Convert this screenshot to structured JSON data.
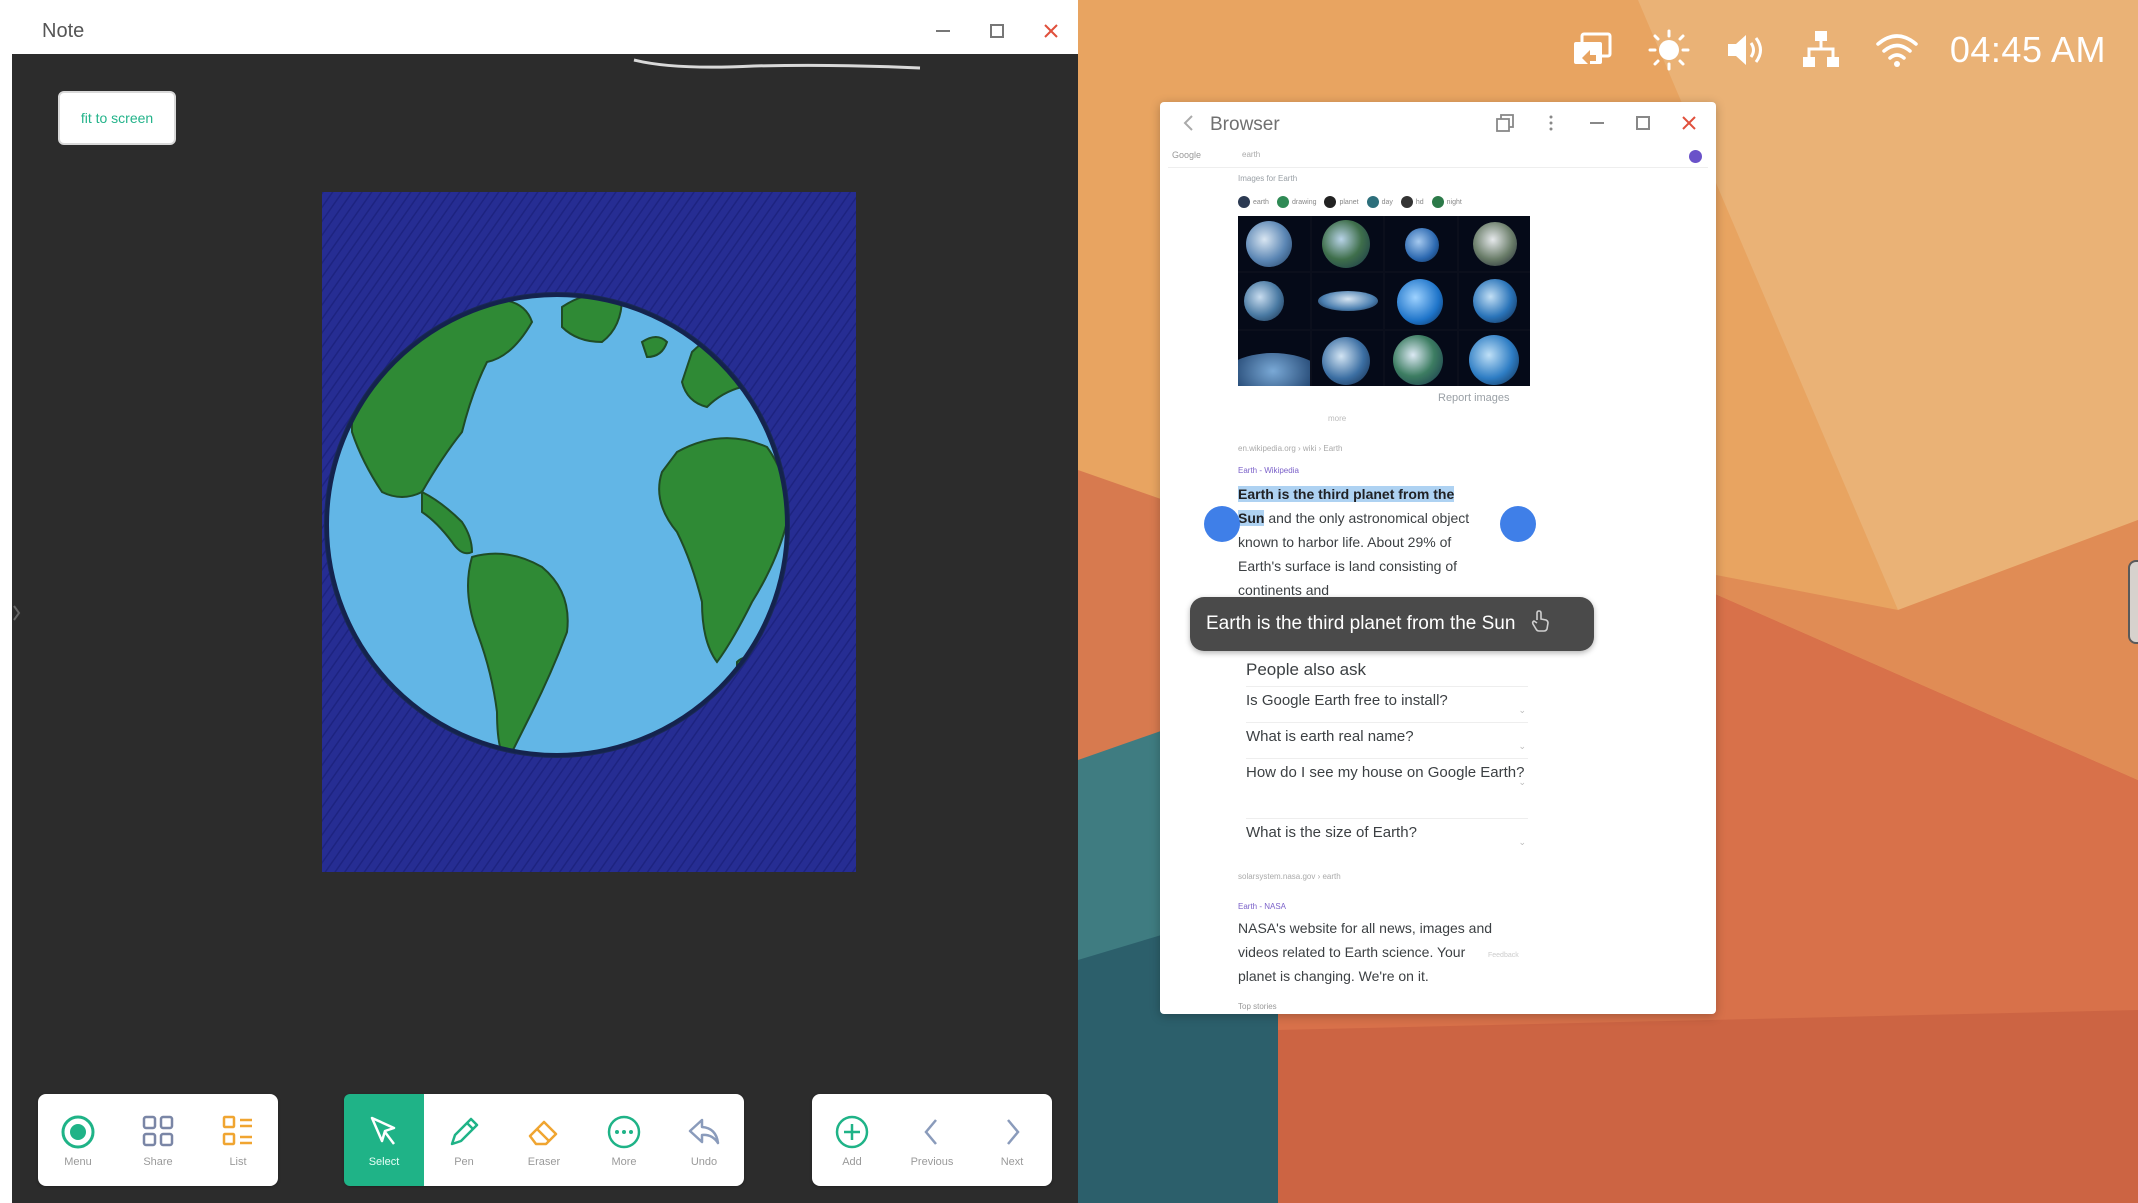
{
  "note": {
    "title": "Note",
    "fit_to_screen": "fit to screen",
    "toolbar_left": [
      {
        "label": "Menu",
        "icon": "menu-icon"
      },
      {
        "label": "Share",
        "icon": "share-icon"
      },
      {
        "label": "List",
        "icon": "list-icon"
      }
    ],
    "toolbar_center": [
      {
        "label": "Select",
        "icon": "select-icon",
        "active": true
      },
      {
        "label": "Pen",
        "icon": "pen-icon"
      },
      {
        "label": "Eraser",
        "icon": "eraser-icon"
      },
      {
        "label": "More",
        "icon": "more-icon"
      },
      {
        "label": "Undo",
        "icon": "undo-icon"
      }
    ],
    "toolbar_right": [
      {
        "label": "Add",
        "icon": "add-icon"
      },
      {
        "label": "Previous",
        "icon": "previous-icon"
      },
      {
        "label": "Next",
        "icon": "next-icon"
      }
    ]
  },
  "statusbar": {
    "time": "04:45 AM",
    "icons": [
      "screen-share-icon",
      "brightness-icon",
      "volume-icon",
      "network-icon",
      "wifi-icon"
    ]
  },
  "browser": {
    "title": "Browser",
    "search_engine": "Google",
    "query": "earth",
    "images_label": "Images for Earth",
    "chips": [
      "earth",
      "drawing",
      "planet",
      "day",
      "hd",
      "night"
    ],
    "report_images": "Report images",
    "more_label": "more",
    "crumb_wiki": "en.wikipedia.org › wiki › Earth",
    "wiki_source": "Earth - Wikipedia",
    "snippet_highlight": "Earth is the third planet from the Sun",
    "snippet_rest": " and the only astronomical object known to harbor life. About 29% of Earth's surface is land consisting of continents and",
    "toast_text": "Earth is the third planet from the Sun",
    "people_also_ask": "People also ask",
    "questions": [
      "Is Google Earth free to install?",
      "What is earth real name?",
      "How do I see my house on Google Earth?",
      "What is the size of Earth?"
    ],
    "feedback": "Feedback",
    "crumb_nasa": "solarsystem.nasa.gov › earth",
    "nasa_source": "Earth - NASA",
    "nasa_snippet": "NASA's website for all news, images and videos related to Earth science. Your planet is changing. We're on it.",
    "top_stories": "Top stories"
  },
  "colors": {
    "accent": "#1fb387",
    "note_bg": "#2c2c2c",
    "wallpaper_orange": "#e9a561",
    "highlight": "#aed2f2",
    "selection_handle": "#3f7fe8"
  }
}
